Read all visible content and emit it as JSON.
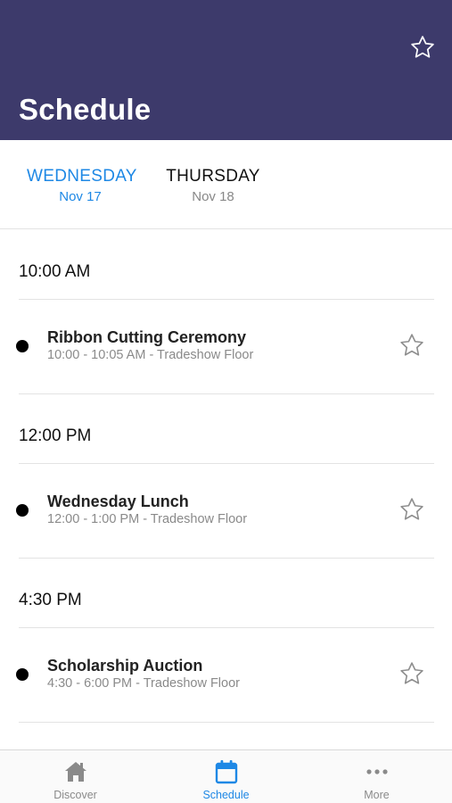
{
  "header": {
    "title": "Schedule",
    "favorites_icon": "star-outline-icon"
  },
  "days": [
    {
      "name": "WEDNESDAY",
      "date": "Nov 17",
      "active": true
    },
    {
      "name": "THURSDAY",
      "date": "Nov 18",
      "active": false
    }
  ],
  "groups": [
    {
      "time": "10:00 AM",
      "sessions": [
        {
          "name": "Ribbon Cutting Ceremony",
          "meta": "10:00 - 10:05 AM - Tradeshow Floor",
          "favorited": false
        }
      ]
    },
    {
      "time": "12:00 PM",
      "sessions": [
        {
          "name": "Wednesday Lunch",
          "meta": "12:00 - 1:00 PM - Tradeshow Floor",
          "favorited": false
        }
      ]
    },
    {
      "time": "4:30 PM",
      "sessions": [
        {
          "name": "Scholarship Auction",
          "meta": "4:30 - 6:00 PM - Tradeshow Floor",
          "favorited": false
        }
      ]
    }
  ],
  "tabs": [
    {
      "label": "Discover",
      "icon": "home-icon",
      "active": false
    },
    {
      "label": "Schedule",
      "icon": "calendar-icon",
      "active": true
    },
    {
      "label": "More",
      "icon": "more-dots-icon",
      "active": false
    }
  ],
  "colors": {
    "header_bg": "#3d3a6b",
    "accent": "#1e88e5",
    "inactive": "#8a8a8a"
  }
}
